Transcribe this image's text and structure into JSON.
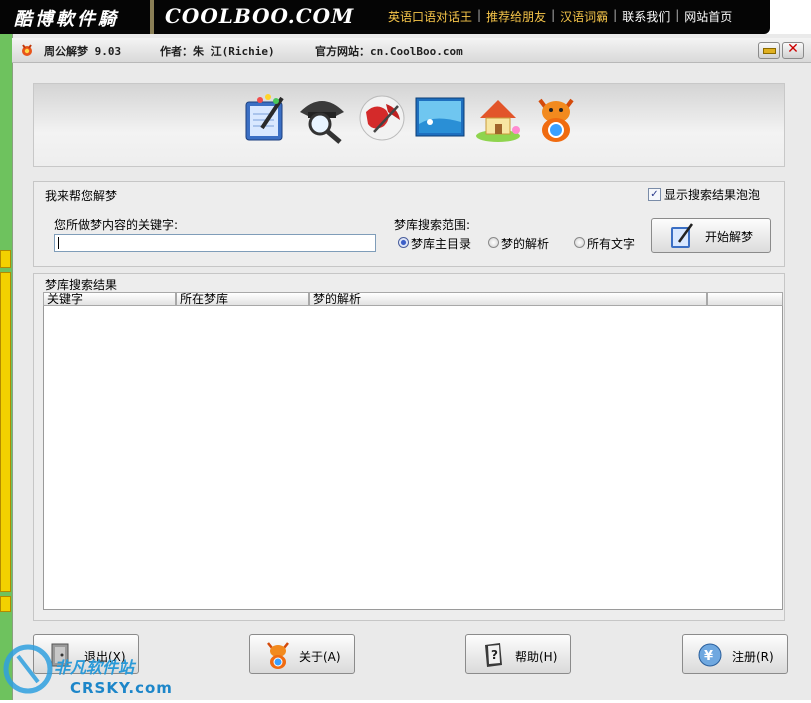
{
  "banner": {
    "logo_cn": "酷博軟件騎",
    "logo_en": "COOLBOO.COM",
    "links": [
      "英语口语对话王",
      "推荐给朋友",
      "汉语词霸",
      "联系我们",
      "网站首页"
    ],
    "separator": "|"
  },
  "window": {
    "app_name": "周公解梦 9.03",
    "author": "作者：朱 江(Richie)",
    "website": "官方网站：cn.CoolBoo.com"
  },
  "toolbar": {
    "tools": [
      {
        "icon": "notepad-pen-icon"
      },
      {
        "icon": "detective-magnifier-icon"
      },
      {
        "icon": "globe-search-icon"
      },
      {
        "icon": "screen-landscape-icon"
      },
      {
        "icon": "house-icon"
      },
      {
        "icon": "mascot-icon"
      }
    ]
  },
  "dream_group": {
    "title": "我来帮您解梦",
    "show_bubble_label": "显示搜索结果泡泡",
    "show_bubble_checked": true,
    "keyword_label": "您所做梦内容的关键字:",
    "keyword_value": "",
    "scope_label": "梦库搜索范围:",
    "scope_options": [
      {
        "label": "梦库主目录",
        "selected": true
      },
      {
        "label": "梦的解析",
        "selected": false
      },
      {
        "label": "所有文字",
        "selected": false
      }
    ],
    "start_button": "开始解梦"
  },
  "results": {
    "title": "梦库搜索结果",
    "columns": [
      "关键字",
      "所在梦库",
      "梦的解析",
      ""
    ]
  },
  "bottom_buttons": {
    "exit": "退出(X)",
    "about": "关于(A)",
    "help": "帮助(H)",
    "register": "注册(R)"
  },
  "watermark": {
    "cn": "非凡软件站",
    "en": "CRSKY.com"
  },
  "colors": {
    "banner_bg": "#050505",
    "banner_link": "#f7c64a",
    "left_strip": "#6ec25e",
    "window_bg": "#eaeaea"
  }
}
